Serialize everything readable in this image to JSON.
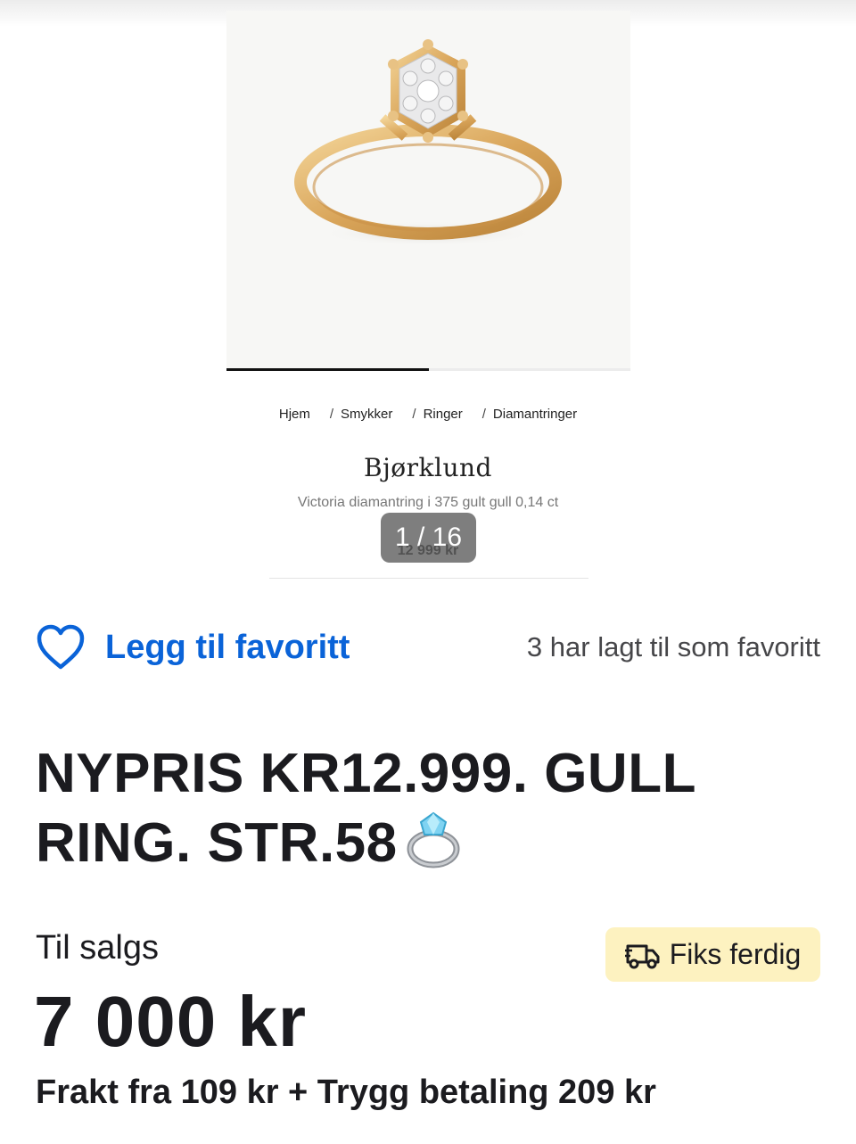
{
  "gallery": {
    "image_alt": "Gold ring with diamond cluster",
    "counter": "1 / 16",
    "progress": 0.5
  },
  "breadcrumb": [
    "Hjem",
    "Smykker",
    "Ringer",
    "Diamantringer"
  ],
  "breadcrumb_separator": "/",
  "brand": "Bjørklund",
  "product_name": "Victoria diamantring i 375 gult gull 0,14 ct",
  "old_price": "12 999 kr",
  "favorite": {
    "label": "Legg til favoritt",
    "count_text": "3 har lagt til som favoritt",
    "icon": "heart-icon"
  },
  "title_lines": [
    "NYPRIS KR12.999. GULL",
    "RING. STR.58"
  ],
  "status": "Til salgs",
  "badge": {
    "label": "Fiks ferdig",
    "icon": "delivery-truck-icon"
  },
  "price": "7 000 kr",
  "shipping": "Frakt fra 109 kr + Trygg betaling 209 kr",
  "colors": {
    "accent": "#0a63d8",
    "badge_bg": "#fdf2c0",
    "text": "#1b1b1f",
    "muted": "#464649"
  }
}
